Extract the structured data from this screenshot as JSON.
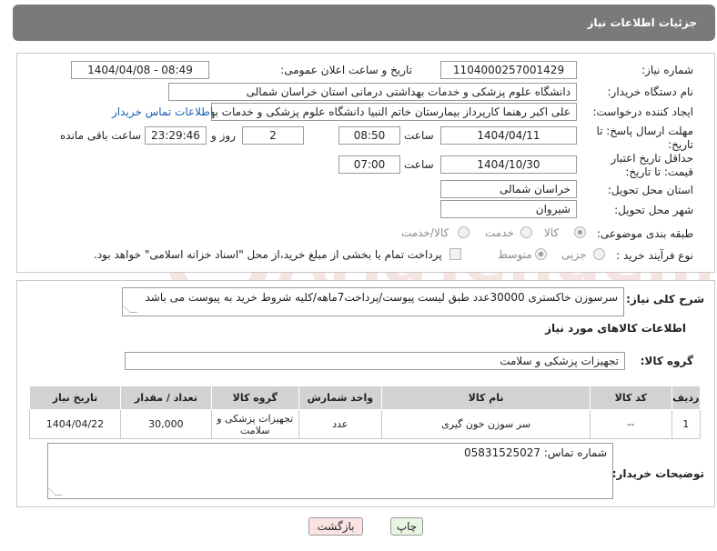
{
  "header": {
    "title": "جزئیات اطلاعات نیاز"
  },
  "form": {
    "need_number_label": "شماره نیاز:",
    "need_number": "1104000257001429",
    "announce_label": "تاریخ و ساعت اعلان عمومی:",
    "announce_value": "1404/04/08 - 08:49",
    "buyer_org_label": "نام دستگاه خریدار:",
    "buyer_org": "دانشگاه علوم پزشکی و خدمات بهداشتی درمانی استان خراسان شمالی",
    "creator_label": "ایجاد کننده درخواست:",
    "creator": "علی اکبر رهنما کارپرداز بیمارستان خاتم النبیا دانشگاه علوم پزشکی و خدمات بهداشتی درمانی استان خراسان شمالی",
    "contact_link": "اطلاعات تماس خریدار",
    "reply_deadline_label": "مهلت ارسال پاسخ: تا تاریخ:",
    "reply_date": "1404/04/11",
    "time_label": "ساعت",
    "reply_time": "08:50",
    "days_value": "2",
    "days_label": "روز و",
    "remaining_time": "23:29:46",
    "remaining_label": "ساعت باقی مانده",
    "price_deadline_label": "حداقل تاریخ اعتبار قیمت: تا تاریخ:",
    "price_date": "1404/10/30",
    "price_time": "07:00",
    "province_label": "استان محل تحویل:",
    "province": "خراسان شمالی",
    "city_label": "شهر محل تحویل:",
    "city": "شیروان",
    "category_label": "طبقه بندی موضوعی:",
    "category_options": [
      "کالا",
      "خدمت",
      "کالا/خدمت"
    ],
    "category_selected": "کالا",
    "process_label": "نوع فرآیند خرید :",
    "process_options": [
      "جزیی",
      "متوسط"
    ],
    "process_selected": "متوسط",
    "payment_note": "پرداخت تمام یا بخشی از مبلغ خرید،از محل \"اسناد خزانه اسلامی\" خواهد بود."
  },
  "description": {
    "label": "شرح کلی نیاز:",
    "text": "سرسوزن خاکستری 30000عدد طبق لیست پیوست/پرداخت7ماهه/کلیه شروط خرید به پیوست می باشد"
  },
  "goods": {
    "section_title": "اطلاعات کالاهای مورد نیاز",
    "group_label": "گروه کالا:",
    "group_value": "تجهیزات پزشکی و سلامت",
    "columns": [
      "ردیف",
      "کد کالا",
      "نام کالا",
      "واحد شمارش",
      "گروه کالا",
      "تعداد / مقدار",
      "تاریخ نیاز"
    ],
    "rows": [
      {
        "row": "1",
        "code": "--",
        "name": "سر سوزن خون گیری",
        "unit": "عدد",
        "group": "تجهیزات پزشکی و سلامت",
        "qty": "30,000",
        "date": "1404/04/22"
      }
    ]
  },
  "buyer_notes": {
    "label": "توضیحات خریدار:",
    "text": "شماره تماس: 05831525027"
  },
  "buttons": {
    "print": "چاپ",
    "back": "بازگشت"
  },
  "watermark": {
    "text": "AriaTender.neT"
  },
  "colors": {
    "header_bg": "#7a7a7a",
    "link": "#1a5fb4",
    "print_btn": "#e8f5e0",
    "back_btn": "#fbe3e3",
    "watermark": "#c0392b"
  }
}
